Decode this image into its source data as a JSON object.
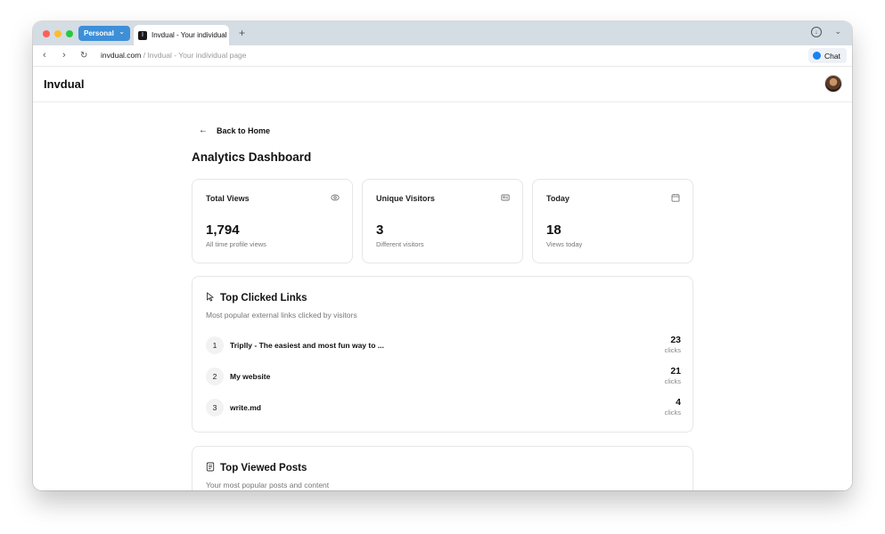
{
  "browser": {
    "profile_label": "Personal",
    "tab_title": "Invdual - Your individual page",
    "tab_favicon": "I",
    "new_tab": "+",
    "url_domain": "invdual.com",
    "url_rest": " / Invdual - Your individual page",
    "chat_label": "Chat"
  },
  "header": {
    "brand": "Invdual"
  },
  "page": {
    "back_label": "Back to Home",
    "title": "Analytics Dashboard"
  },
  "stats": [
    {
      "label": "Total Views",
      "value": "1,794",
      "sub": "All time profile views",
      "icon": "eye-icon"
    },
    {
      "label": "Unique Visitors",
      "value": "3",
      "sub": "Different visitors",
      "icon": "id-card-icon"
    },
    {
      "label": "Today",
      "value": "18",
      "sub": "Views today",
      "icon": "calendar-icon"
    }
  ],
  "top_links": {
    "title": "Top Clicked Links",
    "subtitle": "Most popular external links clicked by visitors",
    "icon": "cursor-icon",
    "items": [
      {
        "rank": "1",
        "name": "Triplly - The easiest and most fun way to ...",
        "clicks": "23",
        "clicks_label": "clicks"
      },
      {
        "rank": "2",
        "name": "My website",
        "clicks": "21",
        "clicks_label": "clicks"
      },
      {
        "rank": "3",
        "name": "write.md",
        "clicks": "4",
        "clicks_label": "clicks"
      }
    ]
  },
  "top_posts": {
    "title": "Top Viewed Posts",
    "subtitle": "Your most popular posts and content",
    "icon": "document-icon"
  },
  "colors": {
    "profile_pill": "#3d8fd8",
    "titlebar": "#d4dce4",
    "card_border": "#e6e6e6",
    "accent_chat": "#1a82f4"
  }
}
